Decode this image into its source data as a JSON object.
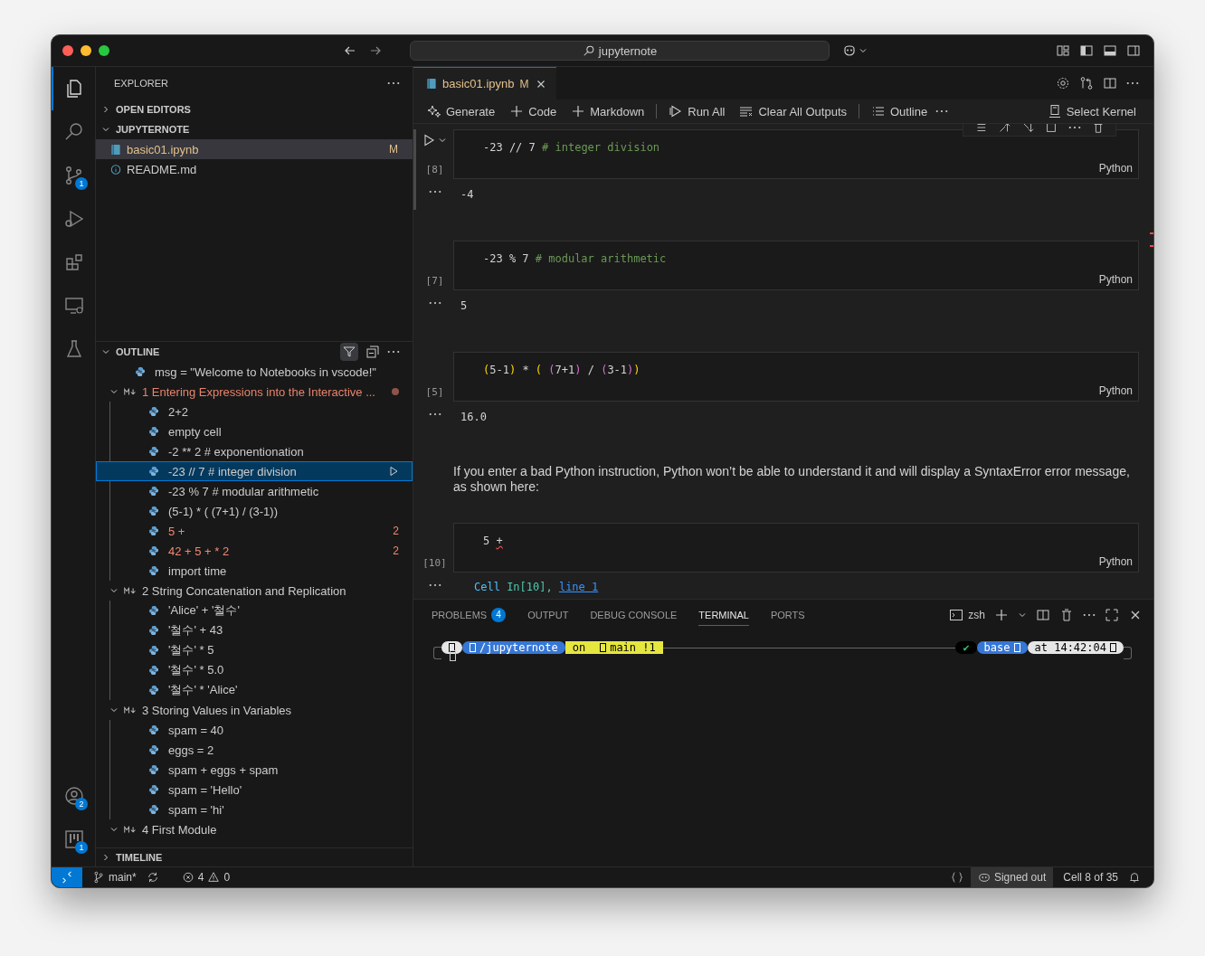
{
  "window": {
    "search": "jupyternote"
  },
  "activity": [
    {
      "kind": "files",
      "selected": true
    },
    {
      "kind": "search",
      "selected": false
    },
    {
      "kind": "scm",
      "selected": false,
      "badge": "1"
    },
    {
      "kind": "debug",
      "selected": false
    },
    {
      "kind": "extensions",
      "selected": false
    },
    {
      "kind": "remote",
      "selected": false
    },
    {
      "kind": "testing",
      "selected": false
    }
  ],
  "activity_bottom": [
    {
      "kind": "account",
      "badge": "2"
    },
    {
      "kind": "board",
      "badge": "1"
    }
  ],
  "explorer": {
    "title": "EXPLORER",
    "sections": [
      {
        "label": "OPEN EDITORS",
        "expanded": false
      },
      {
        "label": "JUPYTERNOTE",
        "expanded": true
      }
    ],
    "files": [
      {
        "name": "basic01.ipynb",
        "kind": "notebook",
        "selected": true,
        "badge": "M"
      },
      {
        "name": "README.md",
        "kind": "info",
        "selected": false
      }
    ]
  },
  "outline": {
    "title": "OUTLINE",
    "items": [
      {
        "kind": "code",
        "text": "msg = \"Welcome to Notebooks in vscode!\"",
        "selected": false,
        "error": false
      },
      {
        "kind": "markdown",
        "text": "1 Entering Expressions into the Interactive ...",
        "expanded": true,
        "modified": true,
        "children": [
          {
            "kind": "code",
            "text": "2+2",
            "selected": false,
            "error": false
          },
          {
            "kind": "code",
            "text": "empty cell",
            "selected": false,
            "error": false
          },
          {
            "kind": "code",
            "text": "-2 ** 2 # exponentionation",
            "selected": false,
            "error": false
          },
          {
            "kind": "code",
            "text": "-23 // 7 # integer division",
            "selected": true,
            "error": false
          },
          {
            "kind": "code",
            "text": "-23 % 7 # modular arithmetic",
            "selected": false,
            "error": false
          },
          {
            "kind": "code",
            "text": "(5-1) * ( (7+1) / (3-1))",
            "selected": false,
            "error": false
          },
          {
            "kind": "code",
            "text": "5 +",
            "selected": false,
            "error": true,
            "count": "2"
          },
          {
            "kind": "code",
            "text": "42 + 5 + * 2",
            "selected": false,
            "error": true,
            "count": "2"
          },
          {
            "kind": "code",
            "text": "import time",
            "selected": false,
            "error": false
          }
        ]
      },
      {
        "kind": "markdown",
        "text": "2 String Concatenation and Replication",
        "expanded": true,
        "modified": false,
        "children": [
          {
            "kind": "code",
            "text": "'Alice' + '철수'",
            "selected": false,
            "error": false
          },
          {
            "kind": "code",
            "text": "'철수' + 43",
            "selected": false,
            "error": false
          },
          {
            "kind": "code",
            "text": "'철수' * 5",
            "selected": false,
            "error": false
          },
          {
            "kind": "code",
            "text": "'철수' * 5.0",
            "selected": false,
            "error": false
          },
          {
            "kind": "code",
            "text": "'철수' * 'Alice'",
            "selected": false,
            "error": false
          }
        ]
      },
      {
        "kind": "markdown",
        "text": "3 Storing Values in Variables",
        "expanded": true,
        "modified": false,
        "children": [
          {
            "kind": "code",
            "text": "spam = 40",
            "selected": false,
            "error": false
          },
          {
            "kind": "code",
            "text": "eggs = 2",
            "selected": false,
            "error": false
          },
          {
            "kind": "code",
            "text": "spam + eggs + spam",
            "selected": false,
            "error": false
          },
          {
            "kind": "code",
            "text": "spam = 'Hello'",
            "selected": false,
            "error": false
          },
          {
            "kind": "code",
            "text": "spam = 'hi'",
            "selected": false,
            "error": false
          }
        ]
      },
      {
        "kind": "markdown",
        "text": "4 First Module",
        "expanded": true,
        "modified": false
      }
    ]
  },
  "timeline": {
    "title": "TIMELINE",
    "expanded": false
  },
  "editor": {
    "tabs": [
      {
        "label": "basic01.ipynb",
        "badge": "M",
        "selected": true
      }
    ],
    "toolbar": [
      {
        "kind": "sparkle",
        "label": "Generate"
      },
      {
        "kind": "plus",
        "label": "Code"
      },
      {
        "kind": "plus",
        "label": "Markdown"
      },
      {
        "kind": "separator"
      },
      {
        "kind": "run",
        "label": "Run All"
      },
      {
        "kind": "clear",
        "label": "Clear All Outputs"
      },
      {
        "kind": "separator"
      },
      {
        "kind": "list",
        "label": "Outline"
      },
      {
        "kind": "more"
      }
    ],
    "kernel": "Select Kernel",
    "cells": [
      {
        "kind": "code",
        "focused": true,
        "count": "[8]",
        "language": "Python",
        "code": [
          {
            "text": "-23 // 7 ",
            "kind": "plain"
          },
          {
            "text": "# integer division",
            "kind": "comment"
          }
        ],
        "output": [
          {
            "text": "-4",
            "kind": "plain"
          }
        ]
      },
      {
        "kind": "code",
        "focused": false,
        "count": "[7]",
        "language": "Python",
        "code": [
          {
            "text": "-23 % 7 ",
            "kind": "plain"
          },
          {
            "text": "# modular arithmetic",
            "kind": "comment"
          }
        ],
        "output": [
          {
            "text": "5",
            "kind": "plain"
          }
        ]
      },
      {
        "kind": "code",
        "focused": false,
        "count": "[5]",
        "language": "Python",
        "code": [
          {
            "text": "(",
            "kind": "p1"
          },
          {
            "text": "5-1",
            "kind": "plain"
          },
          {
            "text": ")",
            "kind": "p1"
          },
          {
            "text": " * ",
            "kind": "plain"
          },
          {
            "text": "( ",
            "kind": "p1"
          },
          {
            "text": "(",
            "kind": "p2"
          },
          {
            "text": "7+1",
            "kind": "plain"
          },
          {
            "text": ")",
            "kind": "p2"
          },
          {
            "text": " / ",
            "kind": "plain"
          },
          {
            "text": "(",
            "kind": "p2"
          },
          {
            "text": "3-1",
            "kind": "plain"
          },
          {
            "text": ")",
            "kind": "p2"
          },
          {
            "text": ")",
            "kind": "p1"
          }
        ],
        "output": [
          {
            "text": "16.0",
            "kind": "plain"
          }
        ]
      },
      {
        "kind": "markdown",
        "text": "If you enter a bad Python instruction, Python won’t be able to understand it and will display a SyntaxError error message, as shown here:"
      },
      {
        "kind": "code",
        "focused": false,
        "count": "[10]",
        "language": "Python",
        "code": [
          {
            "text": "5 ",
            "kind": "plain"
          },
          {
            "text": "+",
            "kind": "error"
          }
        ],
        "output": [
          {
            "text": "Cell ",
            "kind": "teal"
          },
          {
            "text": "In[10], ",
            "kind": "green"
          },
          {
            "text": "line 1",
            "kind": "link"
          }
        ]
      }
    ]
  },
  "panel": {
    "tabs": [
      {
        "label": "PROBLEMS",
        "badge": "4",
        "selected": false
      },
      {
        "label": "OUTPUT",
        "selected": false
      },
      {
        "label": "DEBUG CONSOLE",
        "selected": false
      },
      {
        "label": "TERMINAL",
        "selected": true
      },
      {
        "label": "PORTS",
        "selected": false
      }
    ],
    "shell": "zsh",
    "prompt_left": [
      {
        "kind": "light",
        "glyph": true
      },
      {
        "kind": "blue",
        "glyph": true,
        "text": "/jupyternote"
      },
      {
        "kind": "yellow",
        "glyph": false,
        "text": "on"
      },
      {
        "kind": "yellow",
        "glyph": true,
        "text": "main !1"
      }
    ],
    "prompt_right": [
      {
        "kind": "dark",
        "glyph": false,
        "text": "✔"
      },
      {
        "kind": "blue",
        "text": "base",
        "glyph": true
      },
      {
        "kind": "light",
        "text": "at 14:42:04",
        "glyph": true
      }
    ]
  },
  "status_bar": {
    "branch": "main*",
    "errors": "4",
    "warnings": "0",
    "account": "Signed out",
    "cell": "Cell 8 of 35"
  }
}
